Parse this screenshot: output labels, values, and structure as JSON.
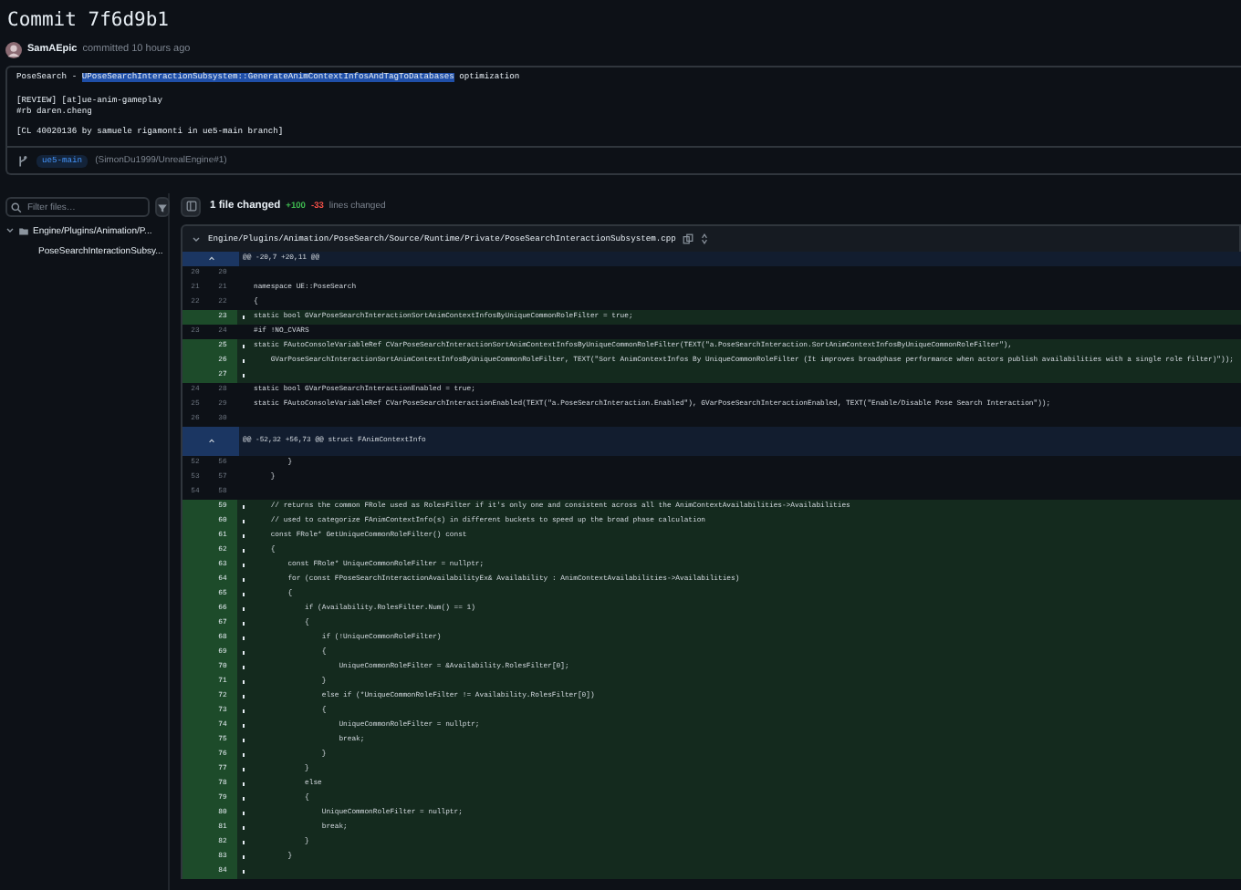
{
  "commit": {
    "title": "Commit 7f6d9b1",
    "author": "SamAEpic",
    "action": "committed 10 hours ago"
  },
  "message": {
    "title": {
      "before": "PoseSearch - ",
      "selected": "UPoseSearchInteractionSubsystem::GenerateAnimContextInfosAndTagToDatabases",
      "after": " optimization"
    },
    "body": [
      "[REVIEW] [at]ue-anim-gameplay",
      "#rb daren.cheng"
    ],
    "footer": "[CL 40020136 by samuele rigamonti in ue5-main branch]",
    "branch": "ue5-main",
    "pull_request": "(SimonDu1999/UnrealEngine#1)"
  },
  "file_filter": {
    "placeholder": "Filter files…"
  },
  "file_tree": [
    {
      "name": "Engine/Plugins/Animation/P...",
      "kind": "folder",
      "expanded": true,
      "children": [
        {
          "name": "PoseSearchInteractionSubsy...",
          "kind": "file"
        }
      ]
    }
  ],
  "summary": {
    "files_changed": "1 file changed",
    "additions": "+100",
    "deletions": "-33",
    "label": "lines changed"
  },
  "file": {
    "path": "Engine/Plugins/Animation/PoseSearch/Source/Runtime/Private/PoseSearchInteractionSubsystem.cpp",
    "expanded": true
  },
  "diff": [
    {
      "kind": "hunk",
      "code": "@@ -20,7 +20,11 @@"
    },
    {
      "kind": "context",
      "old": "20",
      "new": "20"
    },
    {
      "kind": "context",
      "old": "21",
      "new": "21",
      "code": "namespace UE::PoseSearch"
    },
    {
      "kind": "context",
      "old": "22",
      "new": "22",
      "code": "{"
    },
    {
      "kind": "added",
      "new": "23",
      "code": "static bool GVarPoseSearchInteractionSortAnimContextInfosByUniqueCommonRoleFilter = true;"
    },
    {
      "kind": "context",
      "old": "23",
      "new": "24",
      "code": "#if !NO_CVARS"
    },
    {
      "kind": "added",
      "new": "25",
      "code": "static FAutoConsoleVariableRef CVarPoseSearchInteractionSortAnimContextInfosByUniqueCommonRoleFilter(TEXT(\"a.PoseSearchInteraction.SortAnimContextInfosByUniqueCommonRoleFilter\"),"
    },
    {
      "kind": "added",
      "new": "26",
      "code": "\tGVarPoseSearchInteractionSortAnimContextInfosByUniqueCommonRoleFilter, TEXT(\"Sort AnimContextInfos By UniqueCommonRoleFilter (It improves broadphase performance when actors publish availabilities with a single role filter)\"));"
    },
    {
      "kind": "added",
      "new": "27"
    },
    {
      "kind": "context",
      "old": "24",
      "new": "28",
      "code": "static bool GVarPoseSearchInteractionEnabled = true;"
    },
    {
      "kind": "context",
      "old": "25",
      "new": "29",
      "code": "static FAutoConsoleVariableRef CVarPoseSearchInteractionEnabled(TEXT(\"a.PoseSearchInteraction.Enabled\"), GVarPoseSearchInteractionEnabled, TEXT(\"Enable/Disable Pose Search Interaction\"));"
    },
    {
      "kind": "context",
      "old": "26",
      "new": "30"
    },
    {
      "kind": "hunk",
      "code": "@@ -52,32 +56,73 @@ struct FAnimContextInfo"
    },
    {
      "kind": "context",
      "old": "52",
      "new": "56",
      "code": "\t\t}"
    },
    {
      "kind": "context",
      "old": "53",
      "new": "57",
      "code": "\t}"
    },
    {
      "kind": "context",
      "old": "54",
      "new": "58"
    },
    {
      "kind": "added",
      "new": "59",
      "code": "\t// returns the common FRole used as RolesFilter if it's only one and consistent across all the AnimContextAvailabilities->Availabilities"
    },
    {
      "kind": "added",
      "new": "60",
      "code": "\t// used to categorize FAnimContextInfo(s) in different buckets to speed up the broad phase calculation"
    },
    {
      "kind": "added",
      "new": "61",
      "code": "\tconst FRole* GetUniqueCommonRoleFilter() const"
    },
    {
      "kind": "added",
      "new": "62",
      "code": "\t{"
    },
    {
      "kind": "added",
      "new": "63",
      "code": "\t\tconst FRole* UniqueCommonRoleFilter = nullptr;"
    },
    {
      "kind": "added",
      "new": "64",
      "code": "\t\tfor (const FPoseSearchInteractionAvailabilityEx& Availability : AnimContextAvailabilities->Availabilities)"
    },
    {
      "kind": "added",
      "new": "65",
      "code": "\t\t{"
    },
    {
      "kind": "added",
      "new": "66",
      "code": "\t\t\tif (Availability.RolesFilter.Num() == 1)"
    },
    {
      "kind": "added",
      "new": "67",
      "code": "\t\t\t{"
    },
    {
      "kind": "added",
      "new": "68",
      "code": "\t\t\t\tif (!UniqueCommonRoleFilter)"
    },
    {
      "kind": "added",
      "new": "69",
      "code": "\t\t\t\t{"
    },
    {
      "kind": "added",
      "new": "70",
      "code": "\t\t\t\t\tUniqueCommonRoleFilter = &Availability.RolesFilter[0];"
    },
    {
      "kind": "added",
      "new": "71",
      "code": "\t\t\t\t}"
    },
    {
      "kind": "added",
      "new": "72",
      "code": "\t\t\t\telse if (*UniqueCommonRoleFilter != Availability.RolesFilter[0])"
    },
    {
      "kind": "added",
      "new": "73",
      "code": "\t\t\t\t{"
    },
    {
      "kind": "added",
      "new": "74",
      "code": "\t\t\t\t\tUniqueCommonRoleFilter = nullptr;"
    },
    {
      "kind": "added",
      "new": "75",
      "code": "\t\t\t\t\tbreak;"
    },
    {
      "kind": "added",
      "new": "76",
      "code": "\t\t\t\t}"
    },
    {
      "kind": "added",
      "new": "77",
      "code": "\t\t\t}"
    },
    {
      "kind": "added",
      "new": "78",
      "code": "\t\t\telse"
    },
    {
      "kind": "added",
      "new": "79",
      "code": "\t\t\t{"
    },
    {
      "kind": "added",
      "new": "80",
      "code": "\t\t\t\tUniqueCommonRoleFilter = nullptr;"
    },
    {
      "kind": "added",
      "new": "81",
      "code": "\t\t\t\tbreak;"
    },
    {
      "kind": "added",
      "new": "82",
      "code": "\t\t\t}"
    },
    {
      "kind": "added",
      "new": "83",
      "code": "\t\t}"
    },
    {
      "kind": "added",
      "new": "84"
    }
  ]
}
